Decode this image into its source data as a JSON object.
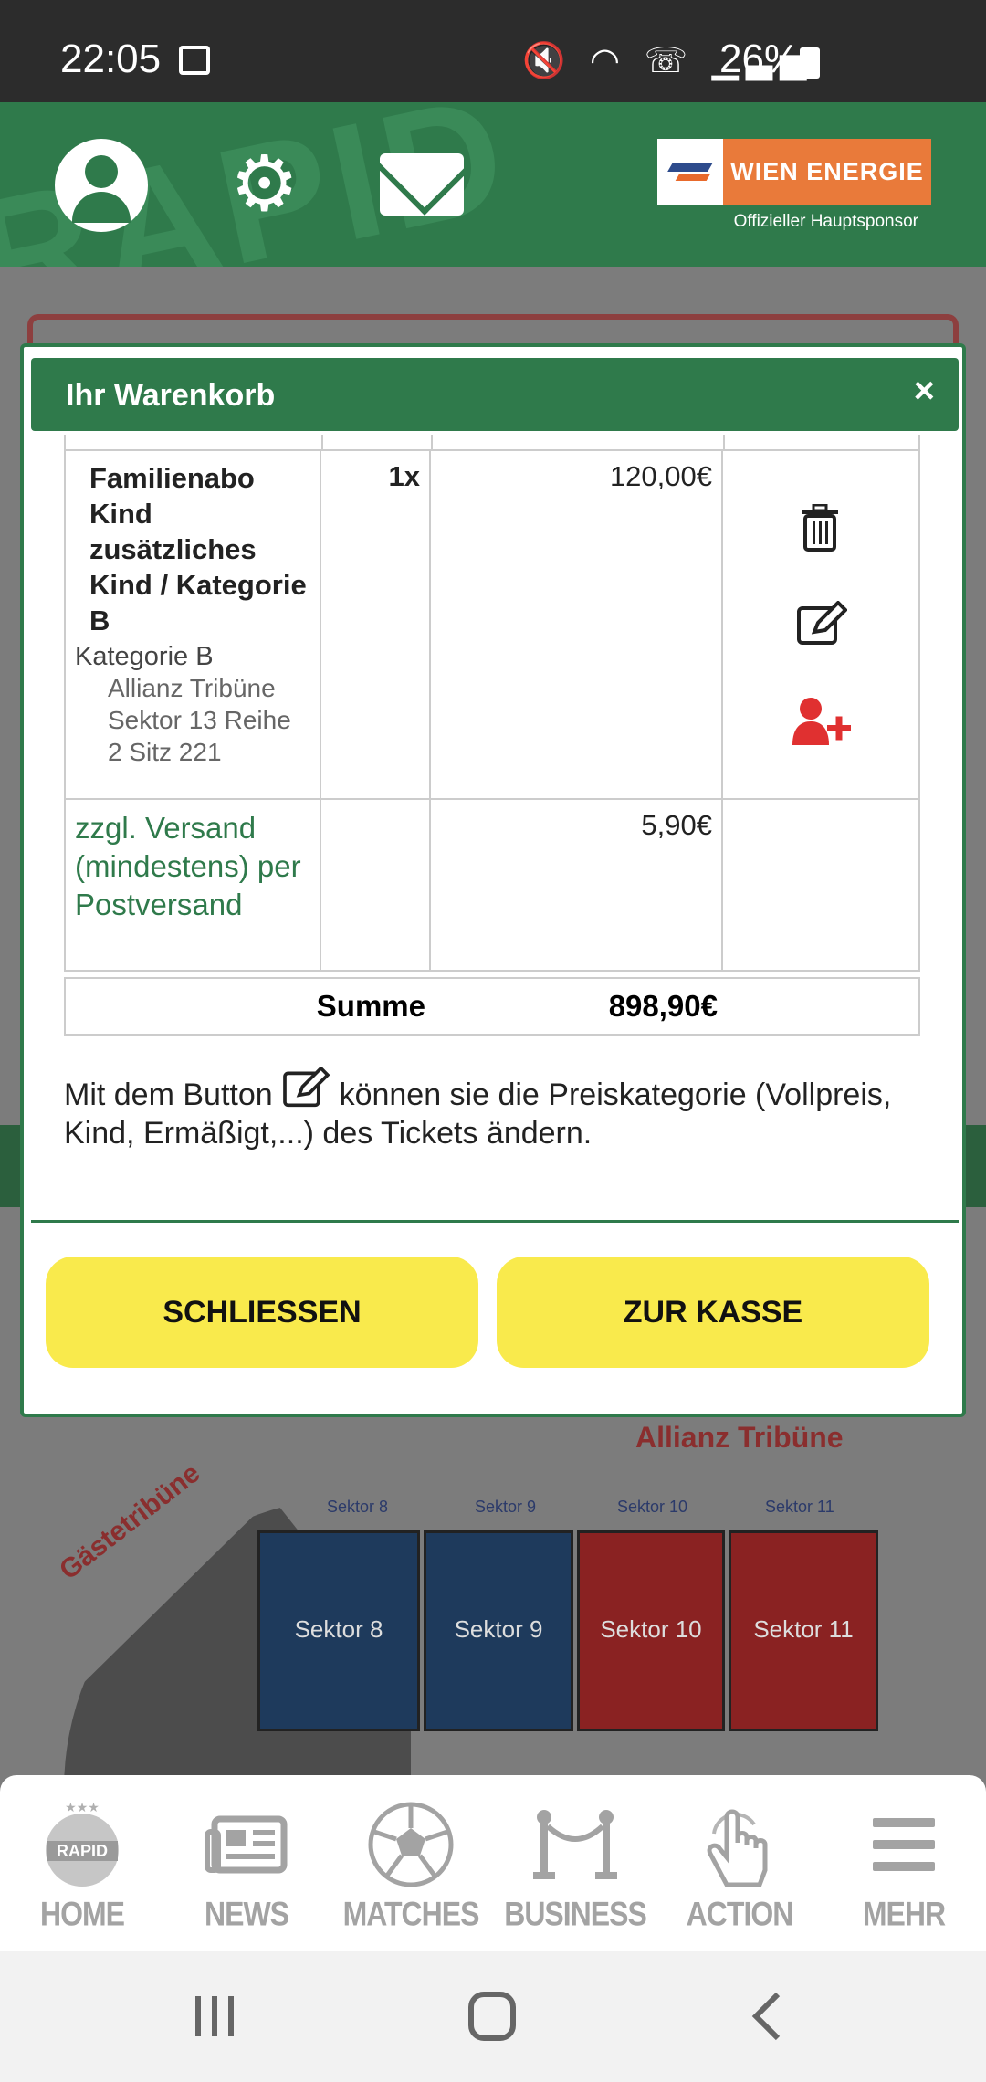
{
  "status_bar": {
    "time": "22:05",
    "battery": "26%"
  },
  "header": {
    "watermark": "RAPID",
    "sponsor_name": "WIEN ENERGIE",
    "sponsor_sub": "Offizieller Hauptsponsor"
  },
  "background": {
    "stadium_title": "Allianz Tribüne",
    "gaeste": "Gästetribüne",
    "sectors": [
      "Sektor 8",
      "Sektor 9",
      "Sektor 10",
      "Sektor 11"
    ]
  },
  "modal": {
    "title": "Ihr Warenkorb",
    "close": "×",
    "item": {
      "name": "Familienabo Kind zusätzliches Kind / Kategorie B",
      "category": "Kategorie B",
      "seat": "Allianz Tribüne Sektor 13 Reihe 2 Sitz 221",
      "qty": "1x",
      "price": "120,00€"
    },
    "shipping": {
      "label": "zzgl. Versand (mindestens) per Postversand",
      "price": "5,90€"
    },
    "sum_label": "Summe",
    "sum_value": "898,90€",
    "hint_before": "Mit dem Button",
    "hint_after": "können sie die Preiskategorie (Vollpreis, Kind, Ermäßigt,...) des Tickets ändern.",
    "btn_close": "SCHLIESSEN",
    "btn_checkout": "ZUR KASSE"
  },
  "nav": [
    "HOME",
    "NEWS",
    "MATCHES",
    "BUSINESS",
    "ACTION",
    "MEHR"
  ],
  "colors": {
    "brand_green": "#2f7a4b",
    "button_yellow": "#f9ea4c",
    "danger_red": "#e03030",
    "sponsor_orange": "#e97a3a"
  }
}
